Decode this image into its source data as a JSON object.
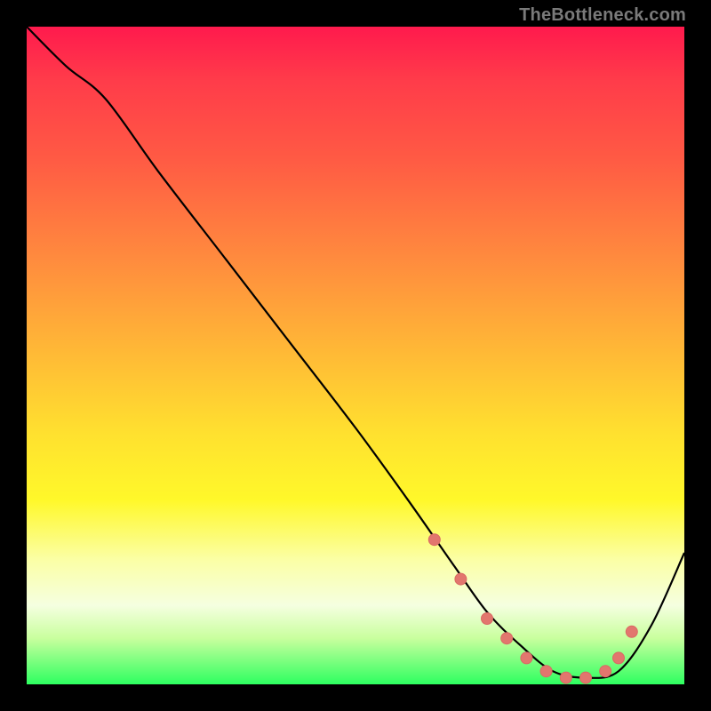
{
  "watermark": "TheBottleneck.com",
  "colors": {
    "curve_stroke": "#000000",
    "marker_fill": "#e2766e",
    "marker_stroke": "#d96a63"
  },
  "chart_data": {
    "type": "line",
    "title": "",
    "xlabel": "",
    "ylabel": "",
    "xlim": [
      0,
      100
    ],
    "ylim": [
      0,
      100
    ],
    "series": [
      {
        "name": "bottleneck-curve",
        "x": [
          0,
          6,
          12,
          20,
          30,
          40,
          50,
          58,
          65,
          70,
          75,
          80,
          85,
          90,
          95,
          100
        ],
        "y": [
          100,
          94,
          89,
          78,
          65,
          52,
          39,
          28,
          18,
          11,
          6,
          2,
          1,
          2,
          9,
          20
        ]
      }
    ],
    "markers": {
      "name": "highlight-dots",
      "x": [
        62,
        66,
        70,
        73,
        76,
        79,
        82,
        85,
        88,
        90,
        92
      ],
      "y": [
        22,
        16,
        10,
        7,
        4,
        2,
        1,
        1,
        2,
        4,
        8
      ]
    }
  }
}
